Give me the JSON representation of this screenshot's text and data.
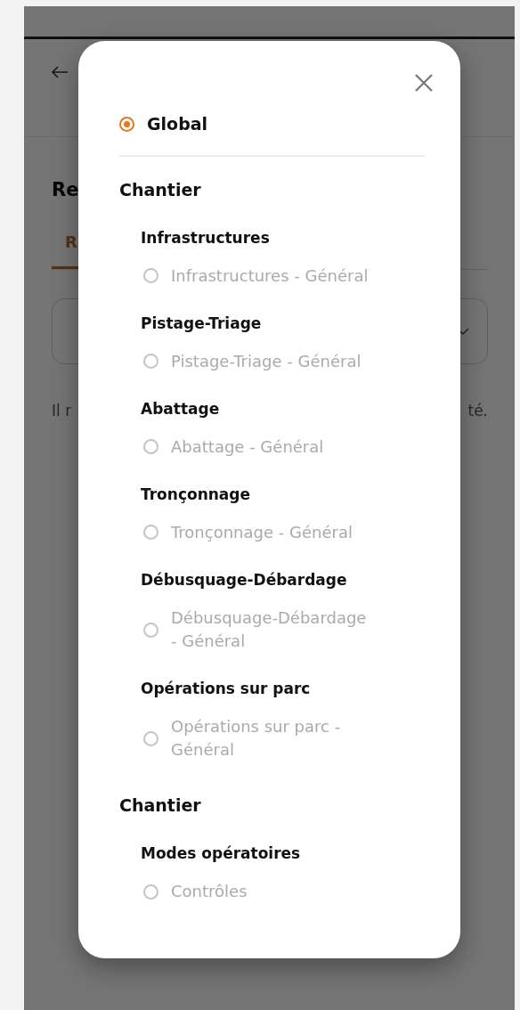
{
  "background": {
    "title": "Re",
    "tab": {
      "label": "R",
      "selected": true
    },
    "message": [
      "Il r",
      "té."
    ]
  },
  "modal": {
    "options": [
      {
        "label": "Global",
        "selected": true
      }
    ],
    "sections": [
      {
        "title": "Chantier",
        "groups": [
          {
            "title": "Infrastructures",
            "options": [
              {
                "label": "Infrastructures - Général",
                "selected": false
              }
            ]
          },
          {
            "title": "Pistage-Triage",
            "options": [
              {
                "label": "Pistage-Triage - Général",
                "selected": false
              }
            ]
          },
          {
            "title": "Abattage",
            "options": [
              {
                "label": "Abattage - Général",
                "selected": false
              }
            ]
          },
          {
            "title": "Tronçonnage",
            "options": [
              {
                "label": "Tronçonnage - Général",
                "selected": false
              }
            ]
          },
          {
            "title": "Débusquage-Débardage",
            "options": [
              {
                "label": "Débusquage-Débardage - Général",
                "selected": false
              }
            ]
          },
          {
            "title": "Opérations sur parc",
            "options": [
              {
                "label": "Opérations sur parc - Général",
                "selected": false
              }
            ]
          }
        ]
      },
      {
        "title": "Chantier",
        "groups": [
          {
            "title": "Modes opératoires",
            "options": [
              {
                "label": "Contrôles",
                "selected": false
              }
            ]
          }
        ]
      }
    ]
  }
}
